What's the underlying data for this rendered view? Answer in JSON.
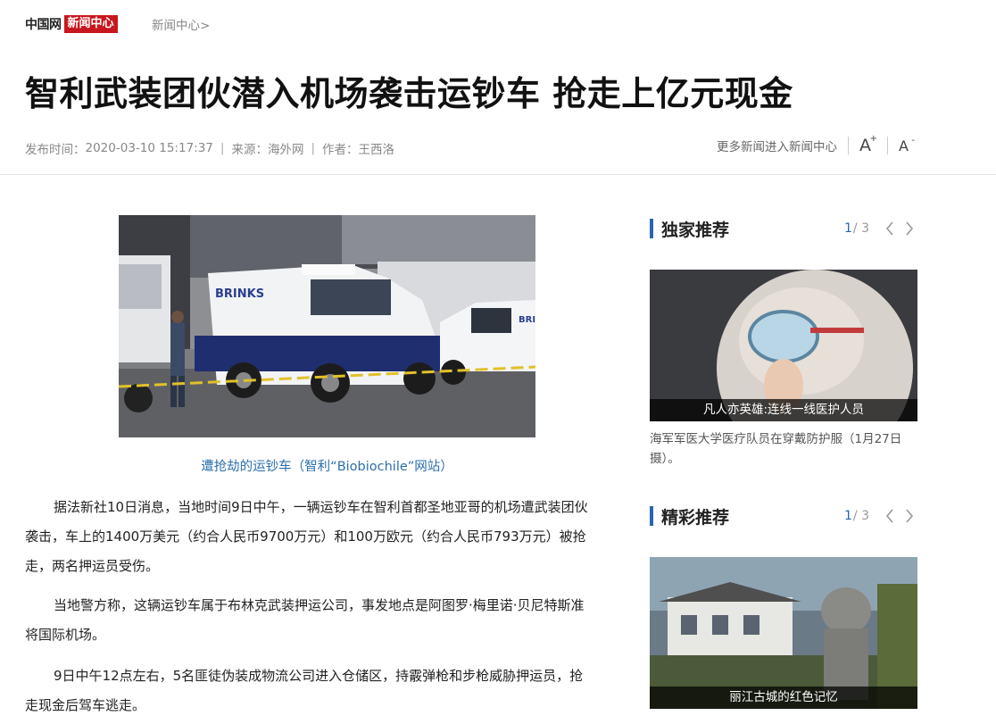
{
  "header": {
    "logo_text": "中国网",
    "logo_badge": "新闻中心",
    "breadcrumb": "新闻中心>"
  },
  "article": {
    "title": "智利武装团伙潜入机场袭击运钞车 抢走上亿元现金",
    "publish_label": "发布时间：",
    "publish_time": "2020-03-10 15:17:37",
    "source_label": "来源：",
    "source": "海外网",
    "author_label": "作者：",
    "author": "王西洛",
    "more_link": "更多新闻进入新闻中心",
    "font_up": "A",
    "font_down": "A",
    "image_caption": "遭抢劫的运钞车（智利“Biobiochile”网站）",
    "image_text_truck": "BRINKS",
    "image_text_van": "BRI",
    "paragraphs": [
      "据法新社10日消息，当地时间9日中午，一辆运钞车在智利首都圣地亚哥的机场遭武装团伙袭击，车上的1400万美元（约合人民币9700万元）和100万欧元（约合人民币793万元）被抢走，两名押运员受伤。",
      "当地警方称，这辆运钞车属于布林克武装押运公司，事发地点是阿图罗·梅里诺·贝尼特斯准将国际机场。",
      "9日中午12点左右，5名匪徒伪装成物流公司进入仓储区，持霰弹枪和步枪威胁押运员，抢走现金后驾车逃走。"
    ]
  },
  "sidebar": {
    "exclusive": {
      "title": "独家推荐",
      "page_current": "1",
      "page_total": "/ 3",
      "image_caption": "凡人亦英雄:连线一线医护人员",
      "description": "海军军医大学医疗队员在穿戴防护服（1月27日摄）。"
    },
    "featured": {
      "title": "精彩推荐",
      "page_current": "1",
      "page_total": "/ 3",
      "image_caption": "丽江古城的红色记忆"
    }
  },
  "colors": {
    "brand_red": "#c8161d",
    "accent_blue": "#2a64b0",
    "caption_blue": "#2b6fae"
  }
}
